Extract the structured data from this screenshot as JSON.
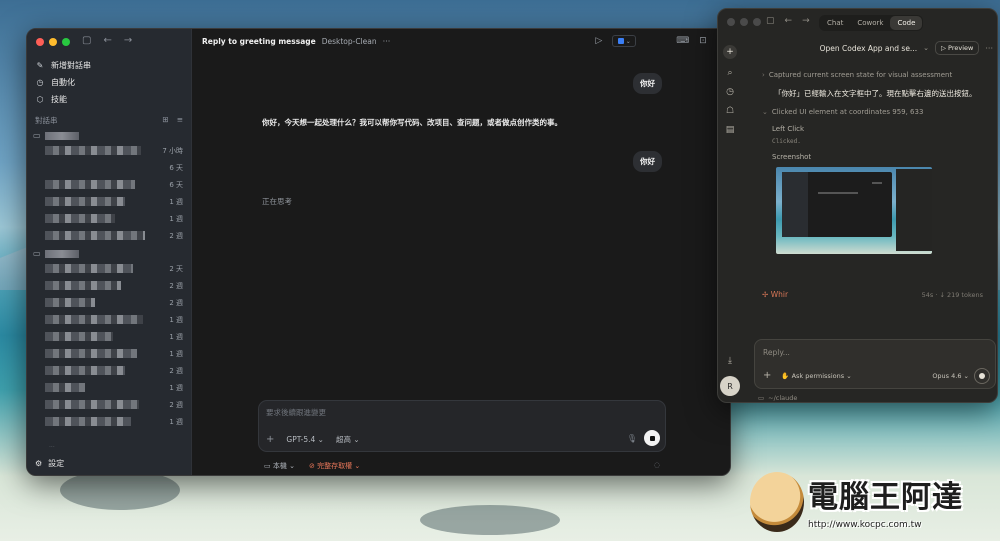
{
  "main_window": {
    "sidebar": {
      "nav": [
        {
          "label": "新增對話串",
          "icon": "compose-icon"
        },
        {
          "label": "自動化",
          "icon": "clock-icon"
        },
        {
          "label": "技能",
          "icon": "cube-icon"
        }
      ],
      "section_label": "對話串",
      "thread_times": [
        "7 小時",
        "6 天",
        "6 天",
        "1 週",
        "1 週",
        "2 週",
        "2 天",
        "2 週",
        "2 週",
        "1 週",
        "1 週",
        "1 週",
        "2 週",
        "1 週",
        "2 週",
        "1 週"
      ],
      "settings_label": "設定"
    },
    "header": {
      "title": "Reply to greeting message",
      "project": "Desktop-Clean",
      "more": "···"
    },
    "messages": {
      "user_1": "你好",
      "assistant_1": "你好，今天想一起处理什么？我可以帮你写代码、改项目、查问题，或者做点创作类的事。",
      "user_2": "你好",
      "status": "正在思考"
    },
    "composer": {
      "placeholder": "要求後續跟進變更",
      "model": "GPT-5.4",
      "effort": "超高"
    },
    "footer": {
      "local": "本機",
      "access": "完整存取權"
    }
  },
  "claude_window": {
    "tabs": [
      "Chat",
      "Cowork",
      "Code"
    ],
    "active_tab": "Code",
    "session_title": "Open Codex App and se...",
    "preview_label": "Preview",
    "log": {
      "captured": "Captured current screen state for visual assessment",
      "note": "「你好」已經輸入在文字框中了。現在點擊右邊的送出按鈕。",
      "clicked": "Clicked UI element at coordinates 959, 633",
      "left_click_label": "Left Click",
      "left_click_result": "Clicked.",
      "screenshot_label": "Screenshot"
    },
    "status_word": "Whir",
    "status_meta": "54s · ↓ 219 tokens",
    "composer": {
      "placeholder": "Reply...",
      "permissions": "Ask permissions",
      "model": "Opus 4.6"
    },
    "path": "~/claude",
    "avatar_initial": "R"
  },
  "watermark": {
    "brand": "電腦王阿達",
    "url": "http://www.kocpc.com.tw"
  }
}
